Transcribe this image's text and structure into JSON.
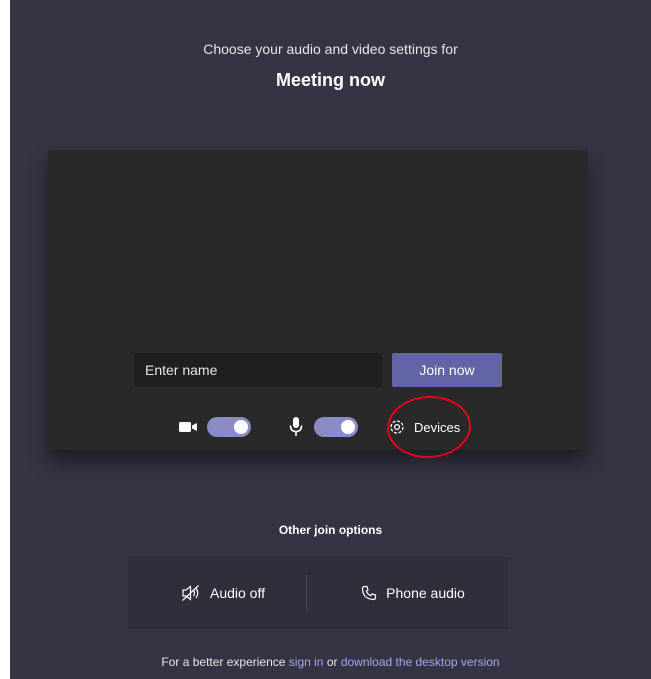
{
  "header": {
    "subtitle": "Choose your audio and video settings for",
    "title": "Meeting now"
  },
  "preview": {
    "name_placeholder": "Enter name",
    "join_label": "Join now",
    "camera": {
      "icon": "camera-icon",
      "toggle_on": true
    },
    "microphone": {
      "icon": "microphone-icon",
      "toggle_on": true
    },
    "devices_label": "Devices",
    "devices_icon": "gear-icon"
  },
  "other_options": {
    "title": "Other join options",
    "audio_off_label": "Audio off",
    "audio_off_icon": "speaker-off-icon",
    "phone_audio_label": "Phone audio",
    "phone_audio_icon": "phone-icon"
  },
  "footer": {
    "prefix": "For a better experience ",
    "sign_in": "sign in",
    "middle": " or ",
    "download": "download the desktop version"
  },
  "colors": {
    "background": "#353444",
    "preview": "#292929",
    "accent": "#6264a7",
    "toggle": "#8b8cc7",
    "link": "#a6a7e6",
    "annotation": "#e0001b"
  }
}
